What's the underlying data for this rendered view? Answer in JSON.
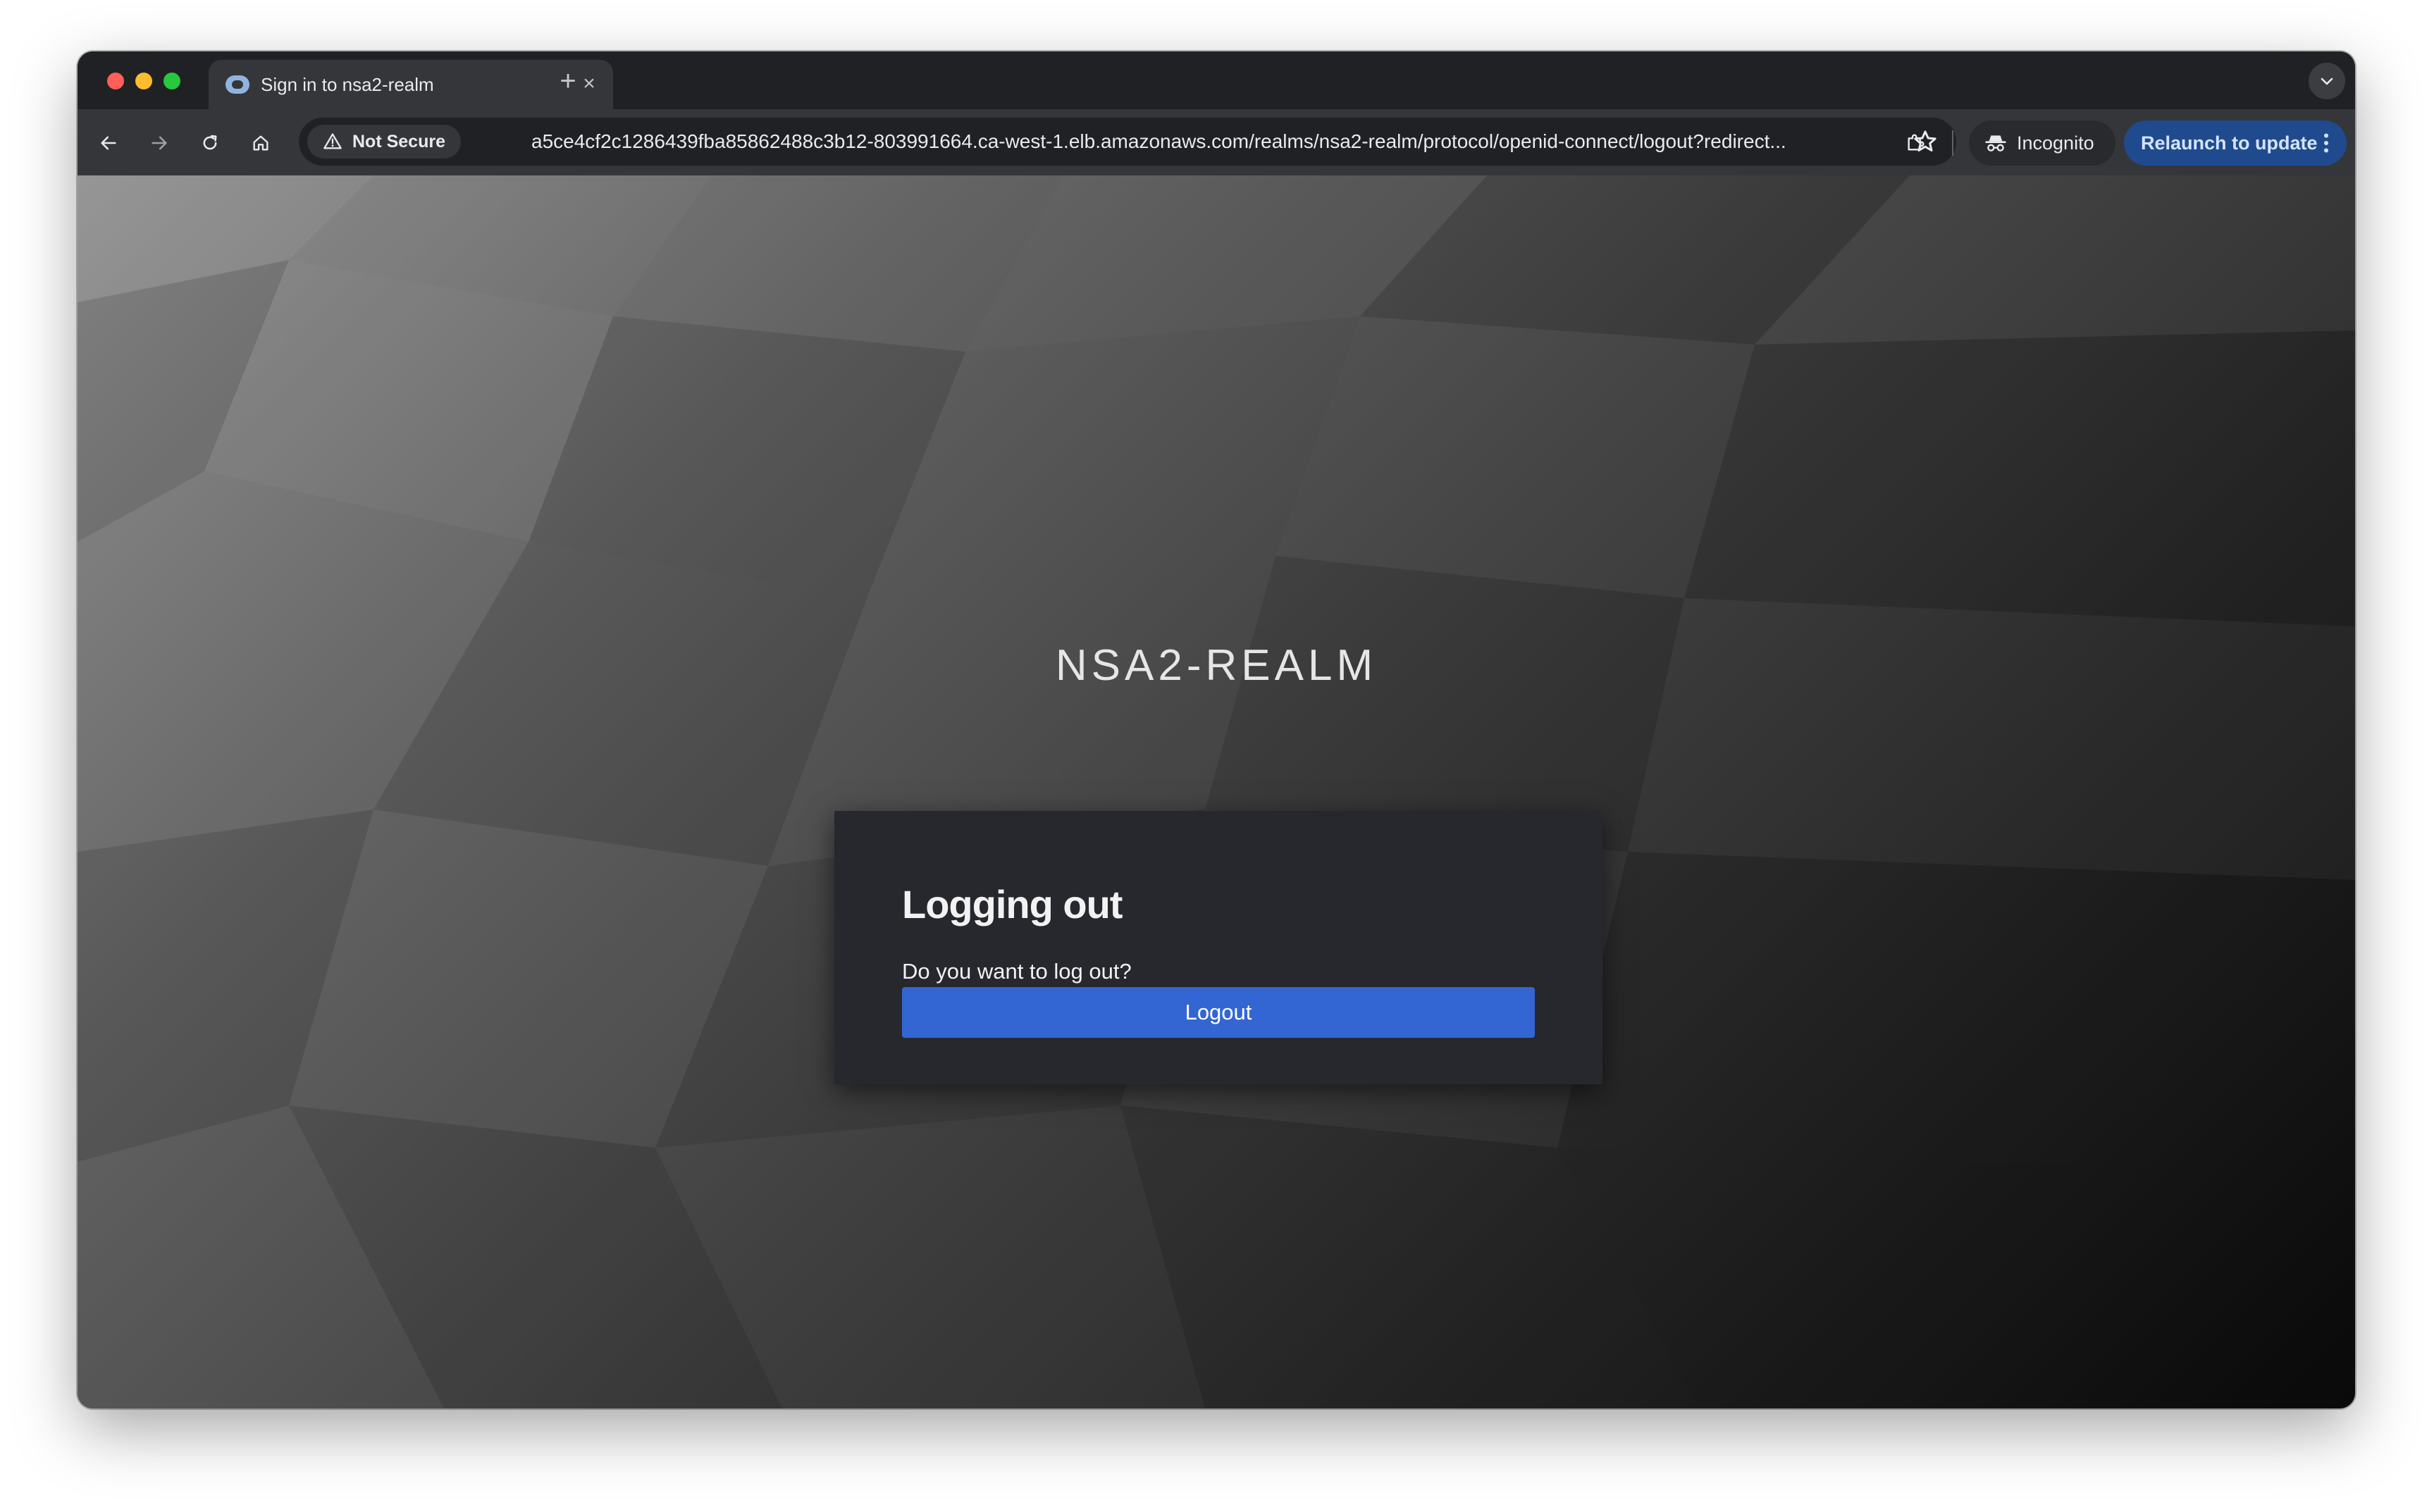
{
  "browser": {
    "tab": {
      "title": "Sign in to nsa2-realm",
      "close_glyph": "×"
    },
    "new_tab_glyph": "+",
    "security_chip": "Not Secure",
    "url": "a5ce4cf2c1286439fba85862488c3b12-803991664.ca-west-1.elb.amazonaws.com/realms/nsa2-realm/protocol/openid-connect/logout?redirect...",
    "incognito_label": "Incognito",
    "relaunch_label": "Relaunch to update",
    "icons": {
      "back": "arrow-left-icon",
      "forward": "arrow-right-icon",
      "reload": "reload-icon",
      "home": "home-icon",
      "warning": "warning-triangle-icon",
      "bookmark": "star-icon",
      "extensions": "puzzle-icon",
      "incognito": "incognito-icon",
      "menu": "more-vertical-icon"
    },
    "colors": {
      "accent_relaunch": "#1f4b8e",
      "traffic_red": "#ff5f57",
      "traffic_yellow": "#febc2e",
      "traffic_green": "#28c840"
    }
  },
  "page": {
    "realm_title": "NSA2-REALM",
    "card": {
      "heading": "Logging out",
      "message": "Do you want to log out?",
      "logout_button": "Logout"
    },
    "colors": {
      "card_bg": "#27282d",
      "primary_button": "#3366d3"
    }
  }
}
